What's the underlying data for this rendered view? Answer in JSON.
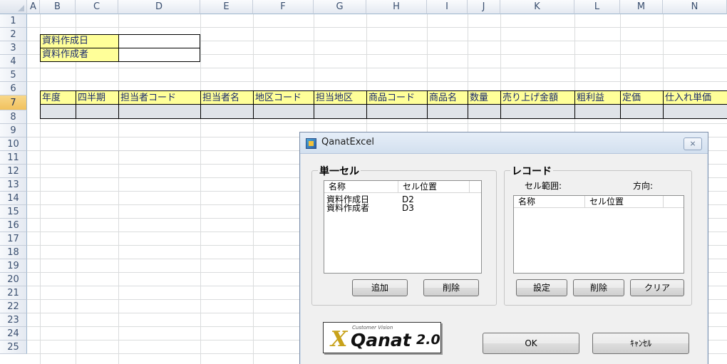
{
  "columns": [
    "A",
    "B",
    "C",
    "D",
    "E",
    "F",
    "G",
    "H",
    "I",
    "J",
    "K",
    "L",
    "M",
    "N"
  ],
  "rows": [
    "1",
    "2",
    "3",
    "4",
    "5",
    "6",
    "7",
    "8",
    "9",
    "10",
    "11",
    "12",
    "13",
    "14",
    "15",
    "16",
    "17",
    "18",
    "19",
    "20",
    "21",
    "22",
    "23",
    "24",
    "25"
  ],
  "cells": {
    "b2": "資料作成日",
    "b3": "資料作成者"
  },
  "table_headers": [
    "年度",
    "四半期",
    "担当者コード",
    "担当者名",
    "地区コード",
    "担当地区",
    "商品コード",
    "商品名",
    "数量",
    "売り上げ金額",
    "粗利益",
    "定価",
    "仕入れ単価"
  ],
  "dialog": {
    "title": "QanatExcel",
    "close": "⨯",
    "single_cell": {
      "group_title": "単一セル",
      "col_name": "名称",
      "col_pos": "セル位置",
      "items": [
        {
          "name": "資料作成日",
          "pos": "D2"
        },
        {
          "name": "資料作成者",
          "pos": "D3"
        }
      ],
      "add": "追加",
      "delete": "削除"
    },
    "record": {
      "group_title": "レコード",
      "range_label": "セル範囲:",
      "direction_label": "方向:",
      "col_name": "名称",
      "col_pos": "セル位置",
      "set": "設定",
      "delete": "削除",
      "clear": "クリア"
    },
    "logo": {
      "small": "Customer Vision",
      "big": "Qanat",
      "version": "2.0",
      "mark": "X"
    },
    "ok": "OK",
    "cancel": "ｷｬﾝｾﾙ"
  },
  "colors": {
    "header_yellow": "#ffff99",
    "selected_header": "#f1c15d",
    "cell_text": "#1a2a6c"
  }
}
